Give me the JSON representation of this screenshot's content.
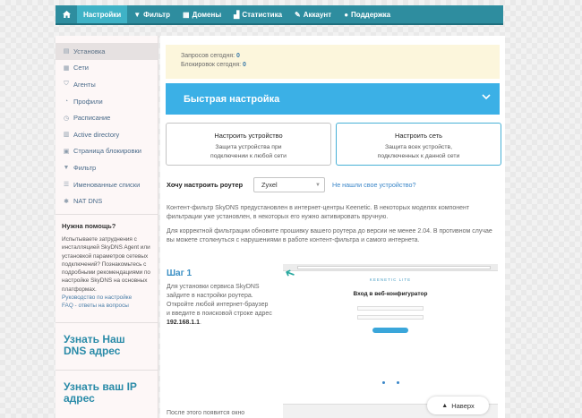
{
  "nav": {
    "home_icon": "home-icon",
    "items": [
      {
        "label": "Настройки",
        "icon": "gear-icon",
        "active": true
      },
      {
        "label": "Фильтр",
        "icon": "filter-icon"
      },
      {
        "label": "Домены",
        "icon": "domains-icon"
      },
      {
        "label": "Статистика",
        "icon": "chart-icon"
      },
      {
        "label": "Аккаунт",
        "icon": "wrench-icon"
      },
      {
        "label": "Поддержка",
        "icon": "user-icon"
      }
    ]
  },
  "sidebar": {
    "items": [
      {
        "label": "Установка",
        "icon": "install-icon"
      },
      {
        "label": "Сети",
        "icon": "network-icon"
      },
      {
        "label": "Агенты",
        "icon": "shield-icon"
      },
      {
        "label": "Профили",
        "icon": "profile-icon"
      },
      {
        "label": "Расписание",
        "icon": "clock-icon"
      },
      {
        "label": "Active directory",
        "icon": "directory-icon"
      },
      {
        "label": "Страница блокировки",
        "icon": "block-page-icon"
      },
      {
        "label": "Фильтр",
        "icon": "filter-icon"
      },
      {
        "label": "Именованные списки",
        "icon": "list-icon"
      },
      {
        "label": "NAT DNS",
        "icon": "nat-icon"
      }
    ],
    "help_title": "Нужна помощь?",
    "help_text": "Испытываете затруднения с инсталляцией SkyDNS Agent или установкой параметров сетевых подключений? Познакомьтесь с подробными рекомендациями по настройке SkyDNS на основных платформах.",
    "help_links": [
      "Руководство по настройке",
      "FAQ - ответы на вопросы"
    ],
    "cta": [
      "Узнать Наш DNS адрес",
      "Узнать ваш IP адрес"
    ]
  },
  "stats": {
    "requests_label": "Запросов сегодня:",
    "requests_value": "0",
    "blocks_label": "Блокировок сегодня:",
    "blocks_value": "0"
  },
  "quick": {
    "title": "Быстрая настройка"
  },
  "options": [
    {
      "title": "Настроить устройство",
      "sub1": "Защита устройства при",
      "sub2": "подключении к любой сети"
    },
    {
      "title": "Настроить сеть",
      "sub1": "Защита всех устройств,",
      "sub2": "подключенных к данной сети"
    }
  ],
  "router": {
    "label": "Хочу настроить роутер",
    "selected": "Zyxel",
    "link": "Не нашли свое устройство?"
  },
  "paragraphs": [
    "Контент-фильтр SkyDNS предустановлен в интернет-центры Keenetic. В некоторых моделях компонент фильтрации уже установлен, в некоторых его нужно активировать вручную.",
    "Для корректной фильтрации обновите прошивку вашего роутера до версии не менее 2.04. В противном случае вы можете столкнуться с нарушениями в работе контент-фильтра и самого интернета."
  ],
  "step": {
    "title": "Шаг 1",
    "text": "Для установки сервиса SkyDNS зайдите в настройки роутера. Откройте любой интернет-браузер и введите в поисковой строке адрес",
    "address": "192.168.1.1",
    "end": "."
  },
  "shot": {
    "brand": "KEENETIC LITE",
    "title": "Вход в веб-конфигуратор"
  },
  "after_text": "После этого появится окно",
  "next_button": {
    "label": "Наверх",
    "icon": "arrow-up-icon"
  }
}
